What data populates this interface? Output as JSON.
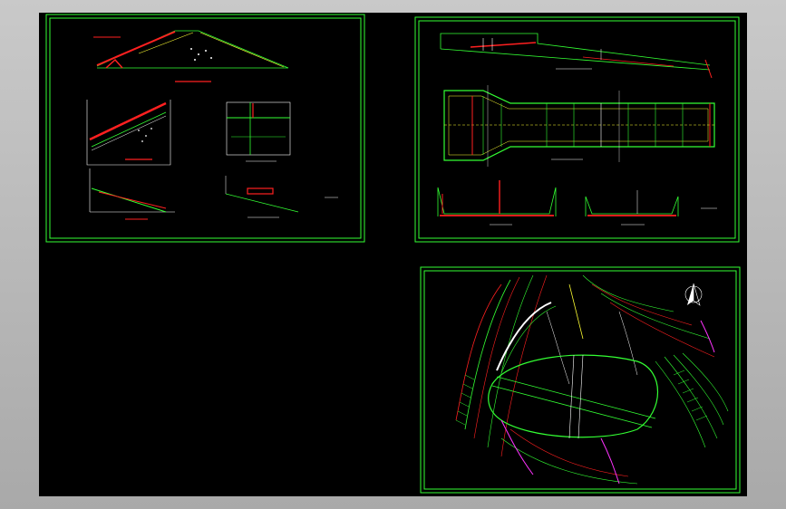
{
  "viewer": {
    "background": "#000000",
    "frame_color": "#b5b5b5"
  },
  "colors": {
    "border": "#33ff33",
    "red": "#ff2020",
    "yellow": "#ffff33",
    "white": "#ffffff",
    "magenta": "#ff33ff",
    "cyan": "#33ffff"
  },
  "sheets": [
    {
      "id": "sheet-1",
      "content": "dam-sections-and-details"
    },
    {
      "id": "sheet-2",
      "content": "spillway-profile-plan-and-cross-sections"
    },
    {
      "id": "sheet-3",
      "content": "site-topographic-plan"
    }
  ],
  "icons": {
    "north_arrow": "north-arrow-icon"
  }
}
